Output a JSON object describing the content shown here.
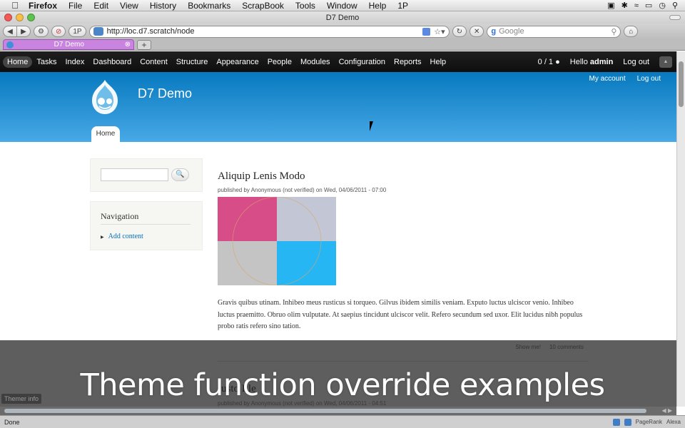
{
  "mac_menu": {
    "app": "Firefox",
    "items": [
      "File",
      "Edit",
      "View",
      "History",
      "Bookmarks",
      "ScrapBook",
      "Tools",
      "Window",
      "Help",
      "1P"
    ]
  },
  "window": {
    "title": "D7 Demo"
  },
  "browser": {
    "url": "http://loc.d7.scratch/node",
    "onepassword_label": "1P",
    "search_placeholder": "Google",
    "tab_title": "D7 Demo",
    "new_tab": "+",
    "status_text": "Done",
    "addon_labels": [
      "PageRank",
      "Alexa"
    ]
  },
  "toolbar": {
    "items": [
      "Home",
      "Tasks",
      "Index",
      "Dashboard",
      "Content",
      "Structure",
      "Appearance",
      "People",
      "Modules",
      "Configuration",
      "Reports",
      "Help"
    ],
    "active": "Home",
    "counter": "0 / 1",
    "hello_prefix": "Hello ",
    "user": "admin",
    "logout": "Log out"
  },
  "header": {
    "site_name": "D7 Demo",
    "secondary_links": [
      "My account",
      "Log out"
    ],
    "primary_tab": "Home"
  },
  "sidebar": {
    "search_button": "🔍",
    "nav_title": "Navigation",
    "nav_link": "Add content"
  },
  "article": {
    "title": "Aliquip Lenis Modo",
    "submitted": "published by Anonymous (not verified) on Wed, 04/06/2011 - 07:00",
    "body": "Gravis quibus utinam. Inhibeo meus rusticus si torqueo. Gilvus ibidem similis veniam. Exputo luctus ulciscor venio. Inhibeo luctus praemitto. Obruo olim vulputate. At saepius tincidunt ulciscor velit. Refero secundum sed uxor. Elit lucidus nibh populus probo ratis refero sino tation.",
    "links": [
      "Show me!",
      "10 comments"
    ],
    "image_colors": {
      "top_left": "#d64d88",
      "top_right": "#c3c7d5",
      "bottom_left": "#c4c4c4",
      "bottom_right": "#27b6f4"
    }
  },
  "article2": {
    "title": "Iusto Ille",
    "submitted": "published by Anonymous (not verified) on Wed, 04/06/2011 - 04:51"
  },
  "themer": "Themer info",
  "caption": "Theme function override examples",
  "colors": {
    "header_top": "#0779bf",
    "header_bottom": "#48a9e6",
    "link": "#0071b3",
    "tab_bg": "#c884de"
  }
}
